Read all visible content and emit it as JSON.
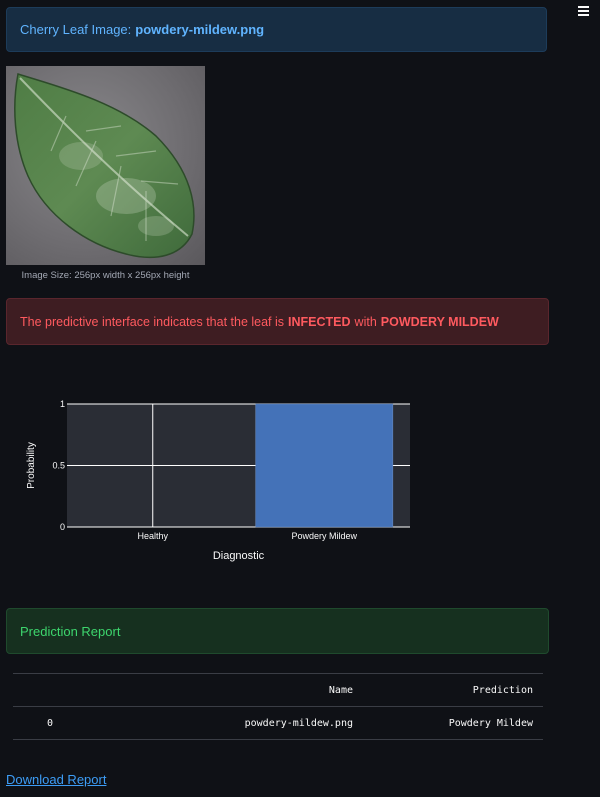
{
  "sidebar": {
    "menu_icon": "hamburger-icon"
  },
  "info": {
    "prefix": "Cherry Leaf Image:",
    "filename": "powdery-mildew.png"
  },
  "image": {
    "caption": "Image Size: 256px width x 256px height"
  },
  "alert": {
    "part1": "The predictive interface indicates that the leaf is",
    "status": "INFECTED",
    "part2": "with",
    "disease": "POWDERY MILDEW"
  },
  "chart_data": {
    "type": "bar",
    "categories": [
      "Healthy",
      "Powdery Mildew"
    ],
    "values": [
      0,
      1
    ],
    "xlabel": "Diagnostic",
    "ylabel": "Probability",
    "ylim": [
      0,
      1
    ],
    "yticks": [
      "0",
      "0.5",
      "1"
    ],
    "grid": true,
    "bar_color": "#4472b8",
    "plot_bg": "#2a2d35"
  },
  "success": {
    "label": "Prediction Report"
  },
  "report": {
    "columns": [
      "",
      "Name",
      "Prediction"
    ],
    "rows": [
      {
        "index": "0",
        "name": "powdery-mildew.png",
        "prediction": "Powdery Mildew"
      }
    ]
  },
  "download": {
    "label": "Download Report"
  },
  "colors": {
    "info_text": "#60b4ff",
    "error_text": "#ff5a5f",
    "success_text": "#3dd56d",
    "link": "#3d9df6"
  }
}
